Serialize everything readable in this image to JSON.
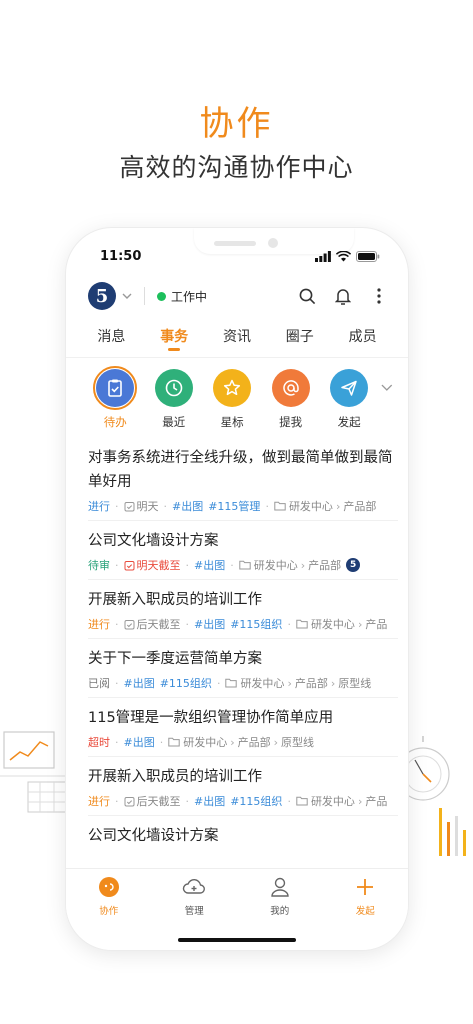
{
  "promo": {
    "title": "协作",
    "subtitle": "高效的沟通协作中心"
  },
  "status_bar": {
    "time": "11:50"
  },
  "header": {
    "logo_text": "5",
    "work_status": "工作中"
  },
  "tabs": [
    {
      "label": "消息"
    },
    {
      "label": "事务"
    },
    {
      "label": "资讯"
    },
    {
      "label": "圈子"
    },
    {
      "label": "成员"
    }
  ],
  "quick_actions": [
    {
      "label": "待办",
      "icon": "clipboard-icon",
      "color": "#4a78d6"
    },
    {
      "label": "最近",
      "icon": "clock-icon",
      "color": "#2fb07a"
    },
    {
      "label": "星标",
      "icon": "star-icon",
      "color": "#f3b21a"
    },
    {
      "label": "提我",
      "icon": "at-icon",
      "color": "#f07a3a"
    },
    {
      "label": "发起",
      "icon": "send-icon",
      "color": "#3aa1d8"
    }
  ],
  "tasks": [
    {
      "title": "对事务系统进行全线升级，做到最简单做到最简单好用",
      "status": "进行",
      "due": "明天",
      "tags": [
        "#出图",
        "#115管理"
      ],
      "path": [
        "研发中心",
        "产品部"
      ]
    },
    {
      "title": "公司文化墙设计方案",
      "status": "待审",
      "due": "明天截至",
      "tags": [
        "#出图"
      ],
      "path": [
        "研发中心",
        "产品部"
      ],
      "avatar": "5"
    },
    {
      "title": "开展新入职成员的培训工作",
      "status": "进行",
      "due": "后天截至",
      "tags": [
        "#出图",
        "#115组织"
      ],
      "path": [
        "研发中心",
        "产品"
      ]
    },
    {
      "title": "关于下一季度运营简单方案",
      "status": "已阅",
      "due": "",
      "tags": [
        "#出图",
        "#115组织"
      ],
      "path": [
        "研发中心",
        "产品部",
        "原型线"
      ]
    },
    {
      "title": "115管理是一款组织管理协作简单应用",
      "status": "超时",
      "due": "",
      "tags": [
        "#出图"
      ],
      "path": [
        "研发中心",
        "产品部",
        "原型线"
      ]
    },
    {
      "title": "开展新入职成员的培训工作",
      "status": "进行",
      "due": "后天截至",
      "tags": [
        "#出图",
        "#115组织"
      ],
      "path": [
        "研发中心",
        "产品"
      ]
    },
    {
      "title": "公司文化墙设计方案",
      "status": "",
      "due": "",
      "tags": [],
      "path": []
    }
  ],
  "bottom_nav": [
    {
      "label": "协作",
      "icon": "chat-bubble-icon"
    },
    {
      "label": "管理",
      "icon": "cloud-plus-icon"
    },
    {
      "label": "我的",
      "icon": "user-icon"
    },
    {
      "label": "发起",
      "icon": "plus-icon"
    }
  ],
  "colors": {
    "accent": "#f08a1c",
    "link": "#3a8bd8",
    "danger": "#e94b3c",
    "online": "#1dbf5c"
  }
}
